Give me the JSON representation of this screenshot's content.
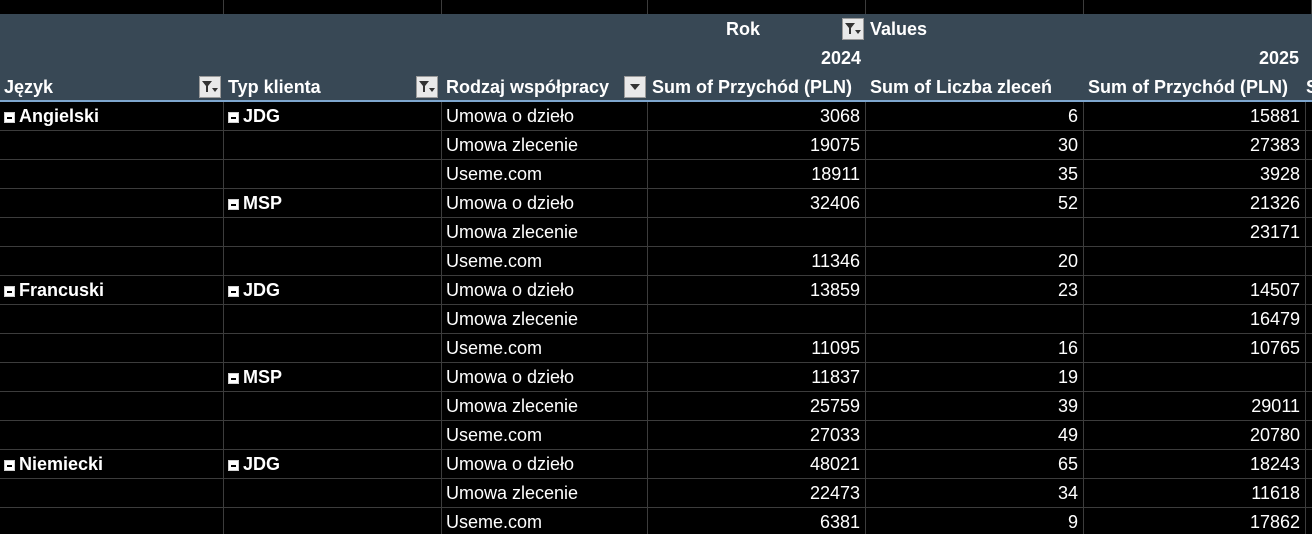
{
  "pivot": {
    "column_field_label": "Rok",
    "values_label": "Values",
    "years": [
      "2024",
      "2025"
    ],
    "row_headers": [
      "Język",
      "Typ klienta",
      "Rodzaj współpracy"
    ],
    "value_headers": [
      "Sum of Przychód (PLN)",
      "Sum of Liczba zleceń",
      "Sum of Przychód (PLN)"
    ],
    "partial_next_header": "S",
    "rows": [
      [
        "Angielski",
        "JDG",
        "Umowa o dzieło",
        "3068",
        "6",
        "15881"
      ],
      [
        "",
        "",
        "Umowa zlecenie",
        "19075",
        "30",
        "27383"
      ],
      [
        "",
        "",
        "Useme.com",
        "18911",
        "35",
        "3928"
      ],
      [
        "",
        "MSP",
        "Umowa o dzieło",
        "32406",
        "52",
        "21326"
      ],
      [
        "",
        "",
        "Umowa zlecenie",
        "",
        "",
        "23171"
      ],
      [
        "",
        "",
        "Useme.com",
        "11346",
        "20",
        ""
      ],
      [
        "Francuski",
        "JDG",
        "Umowa o dzieło",
        "13859",
        "23",
        "14507"
      ],
      [
        "",
        "",
        "Umowa zlecenie",
        "",
        "",
        "16479"
      ],
      [
        "",
        "",
        "Useme.com",
        "11095",
        "16",
        "10765"
      ],
      [
        "",
        "MSP",
        "Umowa o dzieło",
        "11837",
        "19",
        ""
      ],
      [
        "",
        "",
        "Umowa zlecenie",
        "25759",
        "39",
        "29011"
      ],
      [
        "",
        "",
        "Useme.com",
        "27033",
        "49",
        "20780"
      ],
      [
        "Niemiecki",
        "JDG",
        "Umowa o dzieło",
        "48021",
        "65",
        "18243"
      ],
      [
        "",
        "",
        "Umowa zlecenie",
        "22473",
        "34",
        "11618"
      ],
      [
        "",
        "",
        "Useme.com",
        "6381",
        "9",
        "17862"
      ]
    ]
  },
  "icons": {
    "filter": "filter-dropdown-icon",
    "dropdown": "dropdown-arrow-icon",
    "collapse": "collapse-minus-icon"
  },
  "colors": {
    "header_bg": "#384855",
    "body_bg": "#000000",
    "grid_line": "#3c3c3c",
    "text": "#ffffff",
    "header_rule": "#7fa7cf"
  }
}
